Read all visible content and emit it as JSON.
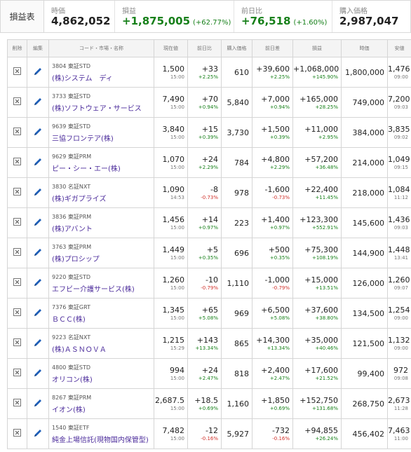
{
  "summary": {
    "title": "損益表",
    "market_value_label": "時価",
    "market_value": "4,862,052",
    "pl_label": "損益",
    "pl_value": "+1,875,005",
    "pl_pct": "(+62.77%)",
    "day_change_label": "前日比",
    "day_change_value": "+76,518",
    "day_change_pct": "(+1.60%)",
    "purchase_label": "購入価格",
    "purchase_value": "2,987,047"
  },
  "table": {
    "headers": [
      "削除",
      "編集",
      "コード・市場・名称",
      "現在値",
      "前日比",
      "購入価格",
      "前日差",
      "損益",
      "時価",
      "安値"
    ],
    "rows": [
      {
        "code": "3804",
        "market": "東証STD",
        "name": "(株)システム　ディ",
        "price": "1,500",
        "time": "15:00",
        "change": "+33",
        "change_pct": "+2.25%",
        "change_dir": "pos",
        "purchase": "610",
        "diff": "+39,600",
        "diff_pct": "+2.25%",
        "diff_dir": "pos",
        "pl": "+1,068,000",
        "pl_pct": "+145.90%",
        "pl_dir": "pos",
        "value": "1,800,000",
        "low": "1,476",
        "low_time": "09:00"
      },
      {
        "code": "3733",
        "market": "東証STD",
        "name": "(株)ソフトウェア・サービス",
        "price": "7,490",
        "time": "15:00",
        "change": "+70",
        "change_pct": "+0.94%",
        "change_dir": "pos",
        "purchase": "5,840",
        "diff": "+7,000",
        "diff_pct": "+0.94%",
        "diff_dir": "pos",
        "pl": "+165,000",
        "pl_pct": "+28.25%",
        "pl_dir": "pos",
        "value": "749,000",
        "low": "7,200",
        "low_time": "09:03"
      },
      {
        "code": "9639",
        "market": "東証STD",
        "name": "三協フロンテア(株)",
        "price": "3,840",
        "time": "15:00",
        "change": "+15",
        "change_pct": "+0.39%",
        "change_dir": "pos",
        "purchase": "3,730",
        "diff": "+1,500",
        "diff_pct": "+0.39%",
        "diff_dir": "pos",
        "pl": "+11,000",
        "pl_pct": "+2.95%",
        "pl_dir": "pos",
        "value": "384,000",
        "low": "3,835",
        "low_time": "09:02"
      },
      {
        "code": "9629",
        "market": "東証PRM",
        "name": "ピー・シー・エー(株)",
        "price": "1,070",
        "time": "15:00",
        "change": "+24",
        "change_pct": "+2.29%",
        "change_dir": "pos",
        "purchase": "784",
        "diff": "+4,800",
        "diff_pct": "+2.29%",
        "diff_dir": "pos",
        "pl": "+57,200",
        "pl_pct": "+36.48%",
        "pl_dir": "pos",
        "value": "214,000",
        "low": "1,049",
        "low_time": "09:15"
      },
      {
        "code": "3830",
        "market": "名証NXT",
        "name": "(株)ギガプライズ",
        "price": "1,090",
        "time": "14:53",
        "change": "-8",
        "change_pct": "-0.73%",
        "change_dir": "neg",
        "purchase": "978",
        "diff": "-1,600",
        "diff_pct": "-0.73%",
        "diff_dir": "neg",
        "pl": "+22,400",
        "pl_pct": "+11.45%",
        "pl_dir": "pos",
        "value": "218,000",
        "low": "1,084",
        "low_time": "11:12"
      },
      {
        "code": "3836",
        "market": "東証PRM",
        "name": "(株)アバント",
        "price": "1,456",
        "time": "15:00",
        "change": "+14",
        "change_pct": "+0.97%",
        "change_dir": "pos",
        "purchase": "223",
        "diff": "+1,400",
        "diff_pct": "+0.97%",
        "diff_dir": "pos",
        "pl": "+123,300",
        "pl_pct": "+552.91%",
        "pl_dir": "pos",
        "value": "145,600",
        "low": "1,436",
        "low_time": "09:03"
      },
      {
        "code": "3763",
        "market": "東証PRM",
        "name": "(株)プロシップ",
        "price": "1,449",
        "time": "15:00",
        "change": "+5",
        "change_pct": "+0.35%",
        "change_dir": "pos",
        "purchase": "696",
        "diff": "+500",
        "diff_pct": "+0.35%",
        "diff_dir": "pos",
        "pl": "+75,300",
        "pl_pct": "+108.19%",
        "pl_dir": "pos",
        "value": "144,900",
        "low": "1,448",
        "low_time": "13:41"
      },
      {
        "code": "9220",
        "market": "東証STD",
        "name": "エフビー介護サービス(株)",
        "price": "1,260",
        "time": "15:00",
        "change": "-10",
        "change_pct": "-0.79%",
        "change_dir": "neg",
        "purchase": "1,110",
        "diff": "-1,000",
        "diff_pct": "-0.79%",
        "diff_dir": "neg",
        "pl": "+15,000",
        "pl_pct": "+13.51%",
        "pl_dir": "pos",
        "value": "126,000",
        "low": "1,260",
        "low_time": "09:07"
      },
      {
        "code": "7376",
        "market": "東証GRT",
        "name": "ＢＣＣ(株)",
        "price": "1,345",
        "time": "15:00",
        "change": "+65",
        "change_pct": "+5.08%",
        "change_dir": "pos",
        "purchase": "969",
        "diff": "+6,500",
        "diff_pct": "+5.08%",
        "diff_dir": "pos",
        "pl": "+37,600",
        "pl_pct": "+38.80%",
        "pl_dir": "pos",
        "value": "134,500",
        "low": "1,254",
        "low_time": "09:00"
      },
      {
        "code": "9223",
        "market": "名証NXT",
        "name": "(株)ＡＳＮＯＶＡ",
        "price": "1,215",
        "time": "15:29",
        "change": "+143",
        "change_pct": "+13.34%",
        "change_dir": "pos",
        "purchase": "865",
        "diff": "+14,300",
        "diff_pct": "+13.34%",
        "diff_dir": "pos",
        "pl": "+35,000",
        "pl_pct": "+40.46%",
        "pl_dir": "pos",
        "value": "121,500",
        "low": "1,132",
        "low_time": "09:00"
      },
      {
        "code": "4800",
        "market": "東証STD",
        "name": "オリコン(株)",
        "price": "994",
        "time": "15:00",
        "change": "+24",
        "change_pct": "+2.47%",
        "change_dir": "pos",
        "purchase": "818",
        "diff": "+2,400",
        "diff_pct": "+2.47%",
        "diff_dir": "pos",
        "pl": "+17,600",
        "pl_pct": "+21.52%",
        "pl_dir": "pos",
        "value": "99,400",
        "low": "972",
        "low_time": "09:08"
      },
      {
        "code": "8267",
        "market": "東証PRM",
        "name": "イオン(株)",
        "price": "2,687.5",
        "time": "15:00",
        "change": "+18.5",
        "change_pct": "+0.69%",
        "change_dir": "pos",
        "purchase": "1,160",
        "diff": "+1,850",
        "diff_pct": "+0.69%",
        "diff_dir": "pos",
        "pl": "+152,750",
        "pl_pct": "+131.68%",
        "pl_dir": "pos",
        "value": "268,750",
        "low": "2,673",
        "low_time": "11:28"
      },
      {
        "code": "1540",
        "market": "東証ETF",
        "name": "純金上場信託(現物国内保管型)",
        "price": "7,482",
        "time": "15:00",
        "change": "-12",
        "change_pct": "-0.16%",
        "change_dir": "neg",
        "purchase": "5,927",
        "diff": "-732",
        "diff_pct": "-0.16%",
        "diff_dir": "neg",
        "pl": "+94,855",
        "pl_pct": "+26.24%",
        "pl_dir": "pos",
        "value": "456,402",
        "low": "7,463",
        "low_time": "11:00"
      }
    ]
  },
  "icons": {
    "delete": "delete-box-icon",
    "edit": "pencil-icon"
  },
  "colors": {
    "positive": "#17801a",
    "negative": "#d0302a",
    "name_link": "#4b2b9b",
    "edit_icon": "#1f5fb8"
  }
}
